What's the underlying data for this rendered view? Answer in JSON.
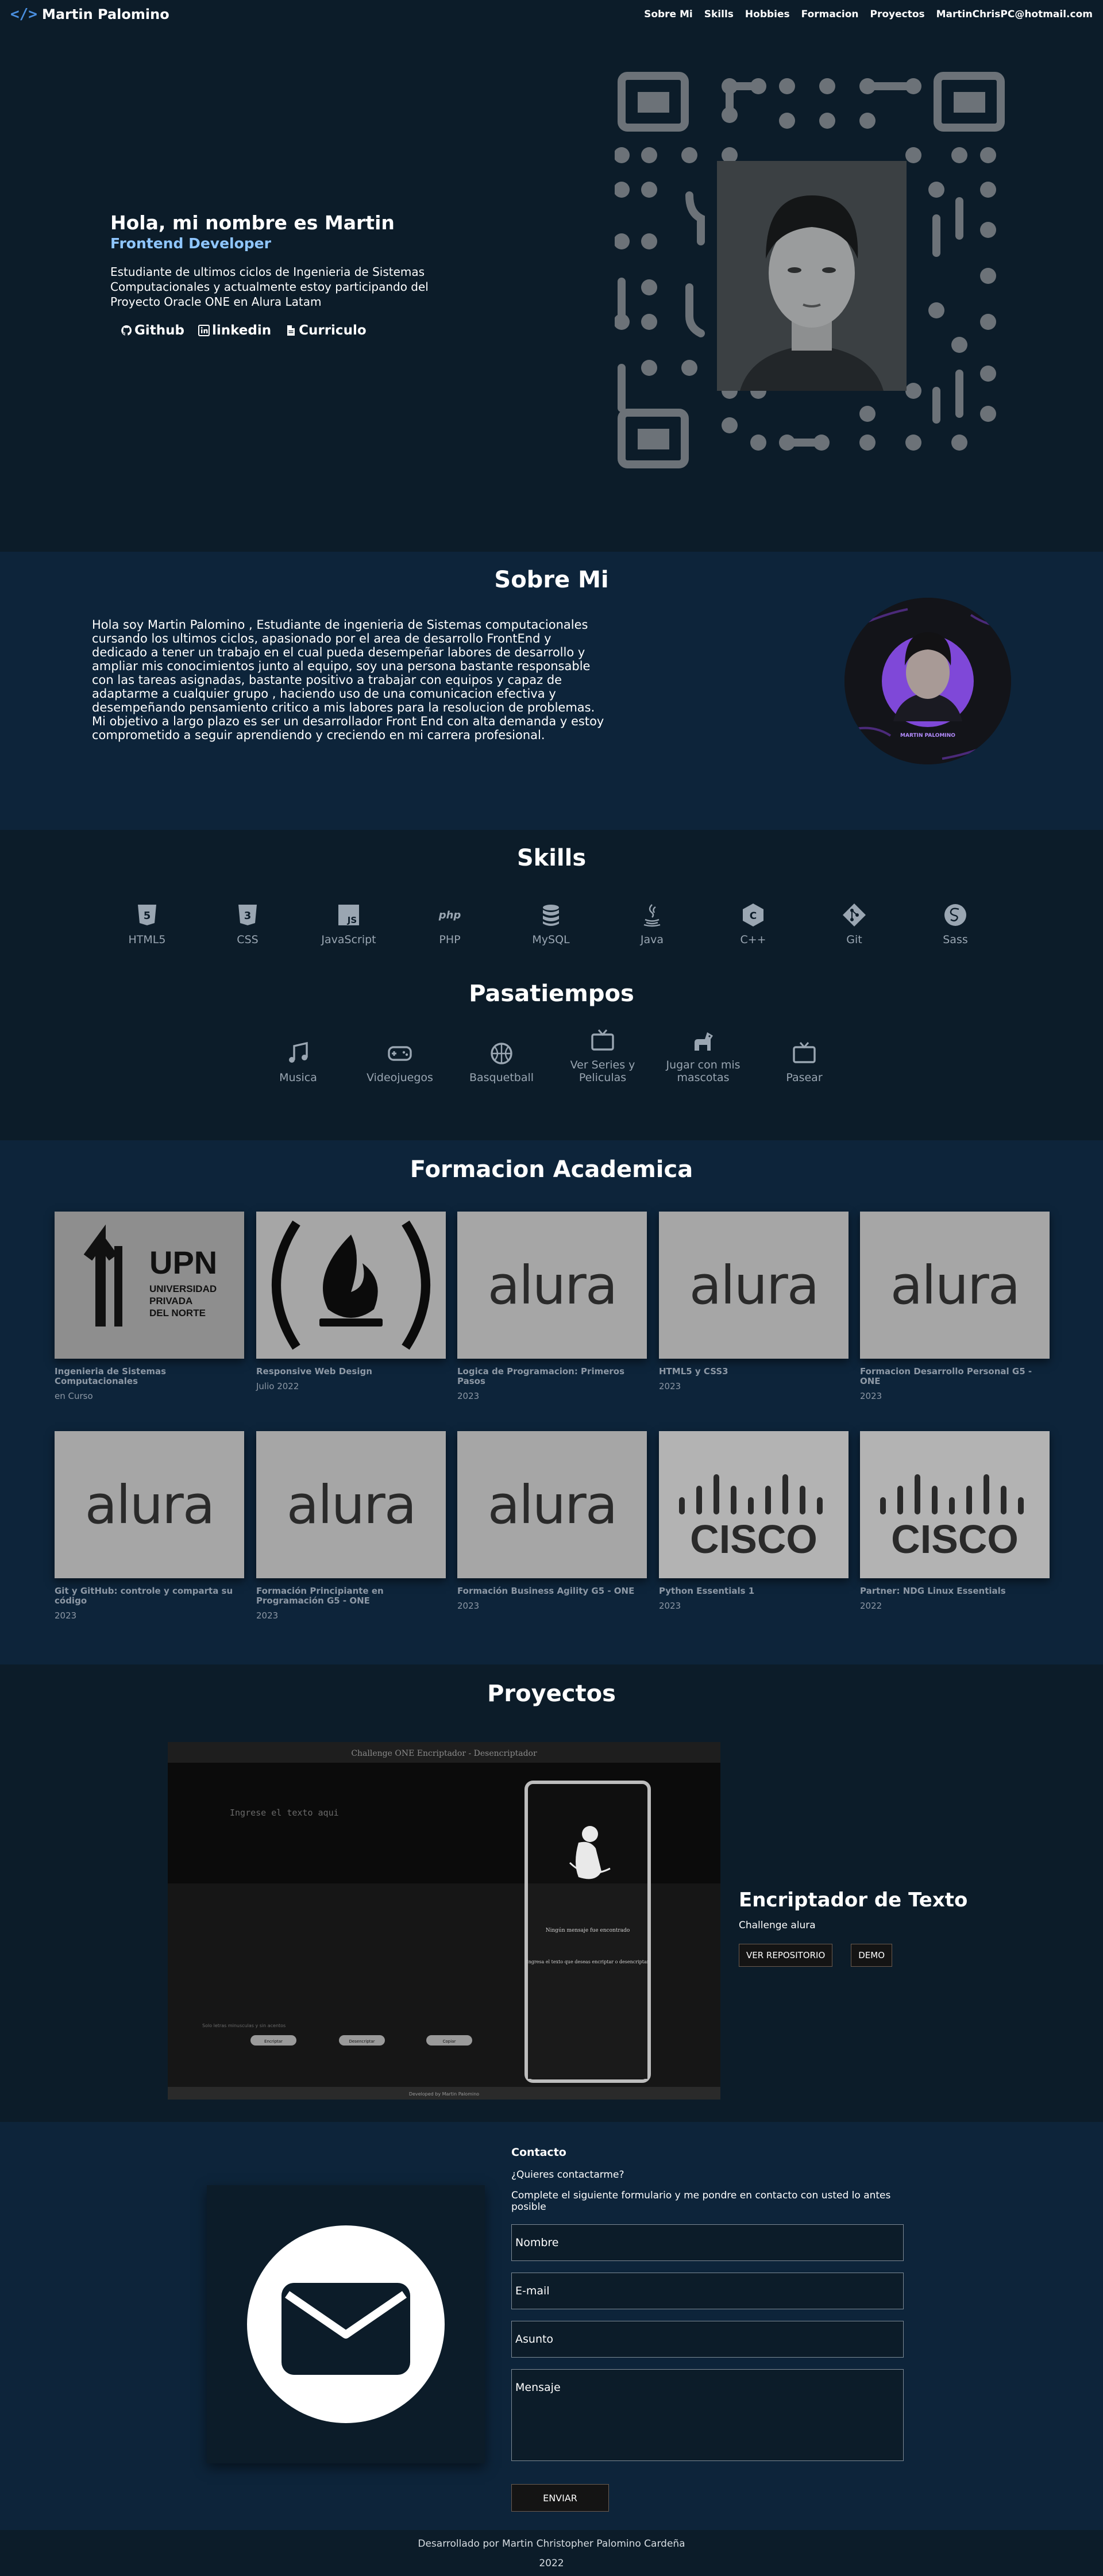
{
  "nav": {
    "brand": "Martin Palomino",
    "brand_icon": "code-icon",
    "links": [
      "Sobre Mi",
      "Skills",
      "Hobbies",
      "Formacion",
      "Proyectos",
      "MartinChrisPC@hotmail.com"
    ]
  },
  "hero": {
    "title": "Hola, mi nombre es Martin",
    "role": "Frontend Developer",
    "description": "Estudiante de ultimos ciclos de Ingenieria de Sistemas Computacionales y actualmente estoy participando del Proyecto Oracle ONE en Alura Latam",
    "links": [
      {
        "label": "Github",
        "icon": "github-icon"
      },
      {
        "label": "linkedin",
        "icon": "linkedin-icon"
      },
      {
        "label": "Curriculo",
        "icon": "document-icon"
      }
    ]
  },
  "about": {
    "title": "Sobre Mi",
    "text": "Hola soy Martin Palomino , Estudiante de ingenieria de Sistemas computacionales cursando los ultimos ciclos, apasionado por el area de desarrollo FrontEnd y dedicado a tener un trabajo en el cual pueda desempeñar labores de desarrollo y ampliar mis conocimientos junto al equipo, soy una persona bastante responsable con las tareas asignadas, bastante positivo a trabajar con equipos y capaz de adaptarme a cualquier grupo , haciendo uso de una comunicacion efectiva y desempeñando pensamiento critico a mis labores para la resolucion de problemas. Mi objetivo a largo plazo es ser un desarrollador Front End con alta demanda y estoy comprometido a seguir aprendiendo y creciendo en mi carrera profesional.",
    "avatar_caption": "MARTIN PALOMINO"
  },
  "skills": {
    "title": "Skills",
    "items": [
      {
        "label": "HTML5",
        "icon": "html5-icon"
      },
      {
        "label": "CSS",
        "icon": "css3-icon"
      },
      {
        "label": "JavaScript",
        "icon": "javascript-icon"
      },
      {
        "label": "PHP",
        "icon": "php-icon"
      },
      {
        "label": "MySQL",
        "icon": "database-icon"
      },
      {
        "label": "Java",
        "icon": "java-icon"
      },
      {
        "label": "C++",
        "icon": "cplusplus-icon"
      },
      {
        "label": "Git",
        "icon": "git-icon"
      },
      {
        "label": "Sass",
        "icon": "sass-icon"
      }
    ]
  },
  "hobbies": {
    "title": "Pasatiempos",
    "items": [
      {
        "label": "Musica",
        "icon": "music-icon"
      },
      {
        "label": "Videojuegos",
        "icon": "gamepad-icon"
      },
      {
        "label": "Basquetball",
        "icon": "basketball-icon"
      },
      {
        "label": "Ver Series y Peliculas",
        "icon": "tv-icon"
      },
      {
        "label": "Jugar con mis mascotas",
        "icon": "dog-icon"
      },
      {
        "label": "Pasear",
        "icon": "tv-icon"
      }
    ]
  },
  "education": {
    "title": "Formacion Academica",
    "upn_logo_text": "UPN",
    "upn_logo_sub": [
      "UNIVERSIDAD",
      "PRIVADA",
      "DEL NORTE"
    ],
    "alura_logo_text": "alura",
    "cisco_logo_text": "CISCO",
    "cards": [
      {
        "title": "Ingenieria de Sistemas Computacionales",
        "date": "en Curso",
        "logo": "upn"
      },
      {
        "title": "Responsive Web Design",
        "date": "Julio 2022",
        "logo": "freecodecamp"
      },
      {
        "title": "Logica de Programacion: Primeros Pasos",
        "date": "2023",
        "logo": "alura"
      },
      {
        "title": "HTML5 y CSS3",
        "date": "2023",
        "logo": "alura"
      },
      {
        "title": "Formacion Desarrollo Personal G5 - ONE",
        "date": "2023",
        "logo": "alura"
      },
      {
        "title": "Git y GitHub: controle y comparta su código",
        "date": "2023",
        "logo": "alura"
      },
      {
        "title": "Formación Principiante en Programación G5 - ONE",
        "date": "2023",
        "logo": "alura"
      },
      {
        "title": "Formación Business Agility G5 - ONE",
        "date": "2023",
        "logo": "alura"
      },
      {
        "title": "Python Essentials 1",
        "date": "2023",
        "logo": "cisco"
      },
      {
        "title": "Partner: NDG Linux Essentials",
        "date": "2022",
        "logo": "cisco"
      }
    ]
  },
  "projects": {
    "title": "Proyectos",
    "screenshot": {
      "window_title": "Challenge ONE Encriptador - Desencriptador",
      "placeholder": "Ingrese el texto aqui",
      "panel_title": "Ningún mensaje fue encontrado",
      "panel_text": "Ingresa el texto que deseas encriptar o desencriptar",
      "hint": "Solo letras minusculas y sin acentos",
      "buttons": [
        "Encriptar",
        "Desencriptar",
        "Copiar"
      ],
      "footer": "Developed by Martin Palomino"
    },
    "item": {
      "title": "Encriptador de Texto",
      "subtitle": "Challenge alura",
      "repo_label": "VER REPOSITORIO",
      "demo_label": "DEMO"
    }
  },
  "contact": {
    "title": "Contacto",
    "question": "¿Quieres contactarme?",
    "description": "Complete el siguiente formulario y me pondre en contacto con usted lo antes posible",
    "name_placeholder": "Nombre",
    "email_placeholder": "E-mail",
    "subject_placeholder": "Asunto",
    "message_placeholder": "Mensaje",
    "submit_label": "ENVIAR",
    "icon": "mail-icon"
  },
  "footer": {
    "credit": "Desarrollado por Martin Christopher Palomino Cardeña",
    "year": "2022"
  },
  "colors": {
    "nav_bg": "#0c1c29",
    "alt_bg": "#0d243a",
    "accent": "#8fc6ff",
    "brand_icon": "#4a8fe0",
    "muted_text": "#9aa6b2",
    "card_bg": "#a6a6a6"
  }
}
